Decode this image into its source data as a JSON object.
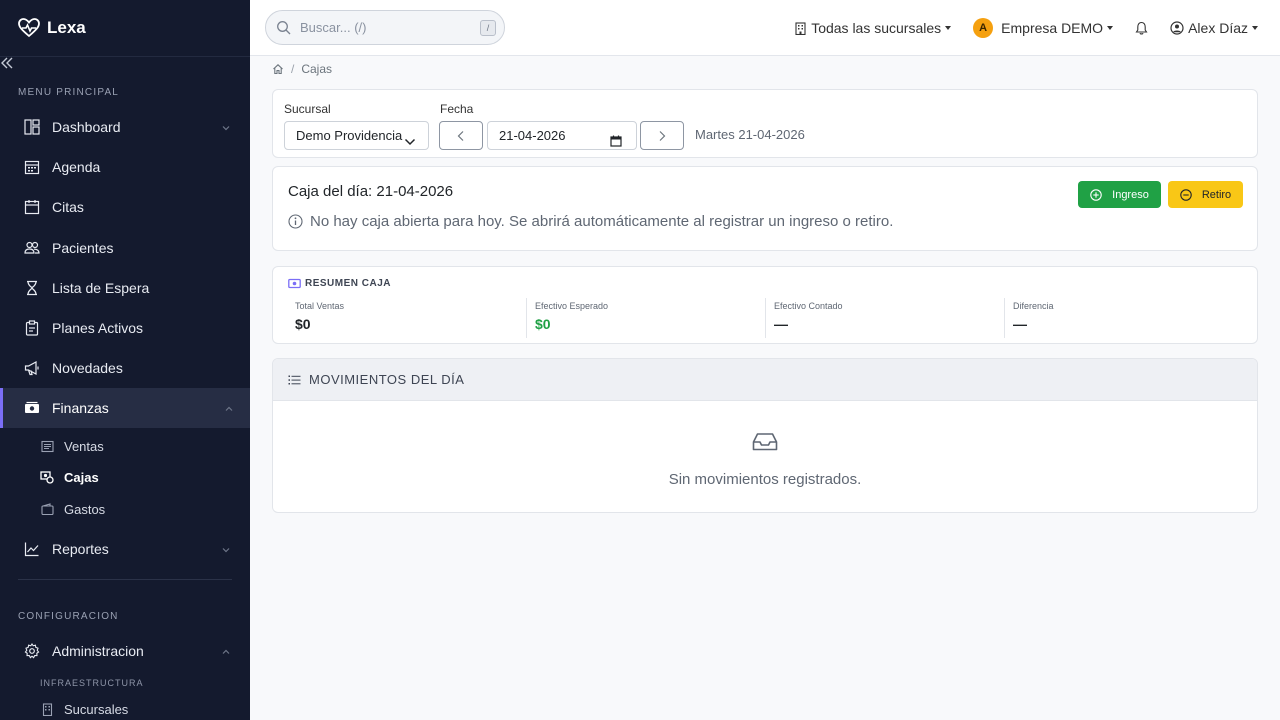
{
  "app": {
    "name": "Lexa"
  },
  "sidebar": {
    "section_main": "MENU PRINCIPAL",
    "items": [
      {
        "label": "Dashboard",
        "icon": "dashboard-icon"
      },
      {
        "label": "Agenda",
        "icon": "calendar-icon"
      },
      {
        "label": "Citas",
        "icon": "calendar-check-icon"
      },
      {
        "label": "Pacientes",
        "icon": "people-icon"
      },
      {
        "label": "Lista de Espera",
        "icon": "hourglass-icon"
      },
      {
        "label": "Planes Activos",
        "icon": "clipboard-icon"
      },
      {
        "label": "Novedades",
        "icon": "megaphone-icon"
      },
      {
        "label": "Finanzas",
        "icon": "cash-icon"
      }
    ],
    "finanzas_sub": [
      {
        "label": "Ventas",
        "icon": "receipt-icon"
      },
      {
        "label": "Cajas",
        "icon": "cash-register-icon"
      },
      {
        "label": "Gastos",
        "icon": "wallet-icon"
      }
    ],
    "reportes": {
      "label": "Reportes",
      "icon": "chart-line-icon"
    },
    "section_config": "CONFIGURACION",
    "admin": {
      "label": "Administracion",
      "icon": "gear-icon"
    },
    "infra_label": "INFRAESTRUCTURA",
    "sucursales": {
      "label": "Sucursales",
      "icon": "building-icon"
    }
  },
  "topbar": {
    "search_placeholder": "Buscar... (/)",
    "search_shortcut": "/",
    "branches": "Todas las sucursales",
    "company_initial": "A",
    "company": "Empresa DEMO",
    "user": "Alex Díaz"
  },
  "breadcrumb": {
    "current": "Cajas"
  },
  "filters": {
    "sucursal_label": "Sucursal",
    "sucursal_value": "Demo Providencia",
    "fecha_label": "Fecha",
    "fecha_value": "21-04-2026",
    "fecha_text": "Martes 21-04-2026"
  },
  "caja": {
    "title": "Caja del día: 21-04-2026",
    "info": "No hay caja abierta para hoy. Se abrirá automáticamente al registrar un ingreso o retiro.",
    "btn_ingreso": "Ingreso",
    "btn_retiro": "Retiro"
  },
  "resumen": {
    "title": "RESUMEN CAJA",
    "stats": [
      {
        "label": "Total Ventas",
        "value": "$0"
      },
      {
        "label": "Efectivo Esperado",
        "value": "$0"
      },
      {
        "label": "Efectivo Contado",
        "value": "—"
      },
      {
        "label": "Diferencia",
        "value": "—"
      }
    ]
  },
  "movimientos": {
    "title": "MOVIMIENTOS DEL DÍA",
    "empty": "Sin movimientos registrados."
  },
  "colors": {
    "accent": "#7b6ef6",
    "success": "#20a145",
    "warning": "#f9c716",
    "sidebar_bg": "#141a2e"
  }
}
